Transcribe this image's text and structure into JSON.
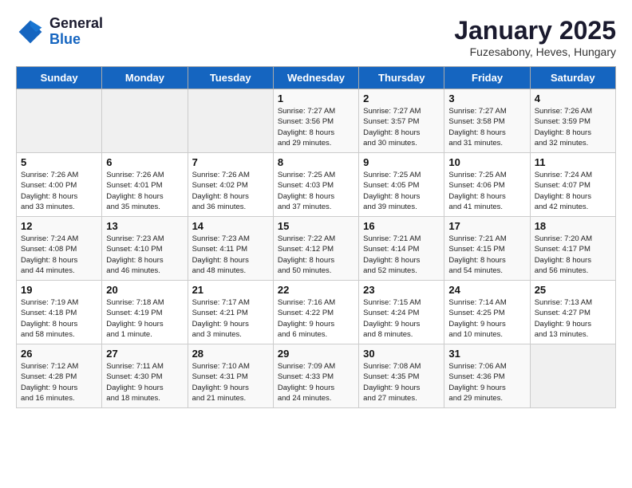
{
  "header": {
    "logo_line1": "General",
    "logo_line2": "Blue",
    "title": "January 2025",
    "subtitle": "Fuzesabony, Heves, Hungary"
  },
  "weekdays": [
    "Sunday",
    "Monday",
    "Tuesday",
    "Wednesday",
    "Thursday",
    "Friday",
    "Saturday"
  ],
  "weeks": [
    [
      {
        "day": "",
        "info": ""
      },
      {
        "day": "",
        "info": ""
      },
      {
        "day": "",
        "info": ""
      },
      {
        "day": "1",
        "info": "Sunrise: 7:27 AM\nSunset: 3:56 PM\nDaylight: 8 hours\nand 29 minutes."
      },
      {
        "day": "2",
        "info": "Sunrise: 7:27 AM\nSunset: 3:57 PM\nDaylight: 8 hours\nand 30 minutes."
      },
      {
        "day": "3",
        "info": "Sunrise: 7:27 AM\nSunset: 3:58 PM\nDaylight: 8 hours\nand 31 minutes."
      },
      {
        "day": "4",
        "info": "Sunrise: 7:26 AM\nSunset: 3:59 PM\nDaylight: 8 hours\nand 32 minutes."
      }
    ],
    [
      {
        "day": "5",
        "info": "Sunrise: 7:26 AM\nSunset: 4:00 PM\nDaylight: 8 hours\nand 33 minutes."
      },
      {
        "day": "6",
        "info": "Sunrise: 7:26 AM\nSunset: 4:01 PM\nDaylight: 8 hours\nand 35 minutes."
      },
      {
        "day": "7",
        "info": "Sunrise: 7:26 AM\nSunset: 4:02 PM\nDaylight: 8 hours\nand 36 minutes."
      },
      {
        "day": "8",
        "info": "Sunrise: 7:25 AM\nSunset: 4:03 PM\nDaylight: 8 hours\nand 37 minutes."
      },
      {
        "day": "9",
        "info": "Sunrise: 7:25 AM\nSunset: 4:05 PM\nDaylight: 8 hours\nand 39 minutes."
      },
      {
        "day": "10",
        "info": "Sunrise: 7:25 AM\nSunset: 4:06 PM\nDaylight: 8 hours\nand 41 minutes."
      },
      {
        "day": "11",
        "info": "Sunrise: 7:24 AM\nSunset: 4:07 PM\nDaylight: 8 hours\nand 42 minutes."
      }
    ],
    [
      {
        "day": "12",
        "info": "Sunrise: 7:24 AM\nSunset: 4:08 PM\nDaylight: 8 hours\nand 44 minutes."
      },
      {
        "day": "13",
        "info": "Sunrise: 7:23 AM\nSunset: 4:10 PM\nDaylight: 8 hours\nand 46 minutes."
      },
      {
        "day": "14",
        "info": "Sunrise: 7:23 AM\nSunset: 4:11 PM\nDaylight: 8 hours\nand 48 minutes."
      },
      {
        "day": "15",
        "info": "Sunrise: 7:22 AM\nSunset: 4:12 PM\nDaylight: 8 hours\nand 50 minutes."
      },
      {
        "day": "16",
        "info": "Sunrise: 7:21 AM\nSunset: 4:14 PM\nDaylight: 8 hours\nand 52 minutes."
      },
      {
        "day": "17",
        "info": "Sunrise: 7:21 AM\nSunset: 4:15 PM\nDaylight: 8 hours\nand 54 minutes."
      },
      {
        "day": "18",
        "info": "Sunrise: 7:20 AM\nSunset: 4:17 PM\nDaylight: 8 hours\nand 56 minutes."
      }
    ],
    [
      {
        "day": "19",
        "info": "Sunrise: 7:19 AM\nSunset: 4:18 PM\nDaylight: 8 hours\nand 58 minutes."
      },
      {
        "day": "20",
        "info": "Sunrise: 7:18 AM\nSunset: 4:19 PM\nDaylight: 9 hours\nand 1 minute."
      },
      {
        "day": "21",
        "info": "Sunrise: 7:17 AM\nSunset: 4:21 PM\nDaylight: 9 hours\nand 3 minutes."
      },
      {
        "day": "22",
        "info": "Sunrise: 7:16 AM\nSunset: 4:22 PM\nDaylight: 9 hours\nand 6 minutes."
      },
      {
        "day": "23",
        "info": "Sunrise: 7:15 AM\nSunset: 4:24 PM\nDaylight: 9 hours\nand 8 minutes."
      },
      {
        "day": "24",
        "info": "Sunrise: 7:14 AM\nSunset: 4:25 PM\nDaylight: 9 hours\nand 10 minutes."
      },
      {
        "day": "25",
        "info": "Sunrise: 7:13 AM\nSunset: 4:27 PM\nDaylight: 9 hours\nand 13 minutes."
      }
    ],
    [
      {
        "day": "26",
        "info": "Sunrise: 7:12 AM\nSunset: 4:28 PM\nDaylight: 9 hours\nand 16 minutes."
      },
      {
        "day": "27",
        "info": "Sunrise: 7:11 AM\nSunset: 4:30 PM\nDaylight: 9 hours\nand 18 minutes."
      },
      {
        "day": "28",
        "info": "Sunrise: 7:10 AM\nSunset: 4:31 PM\nDaylight: 9 hours\nand 21 minutes."
      },
      {
        "day": "29",
        "info": "Sunrise: 7:09 AM\nSunset: 4:33 PM\nDaylight: 9 hours\nand 24 minutes."
      },
      {
        "day": "30",
        "info": "Sunrise: 7:08 AM\nSunset: 4:35 PM\nDaylight: 9 hours\nand 27 minutes."
      },
      {
        "day": "31",
        "info": "Sunrise: 7:06 AM\nSunset: 4:36 PM\nDaylight: 9 hours\nand 29 minutes."
      },
      {
        "day": "",
        "info": ""
      }
    ]
  ]
}
